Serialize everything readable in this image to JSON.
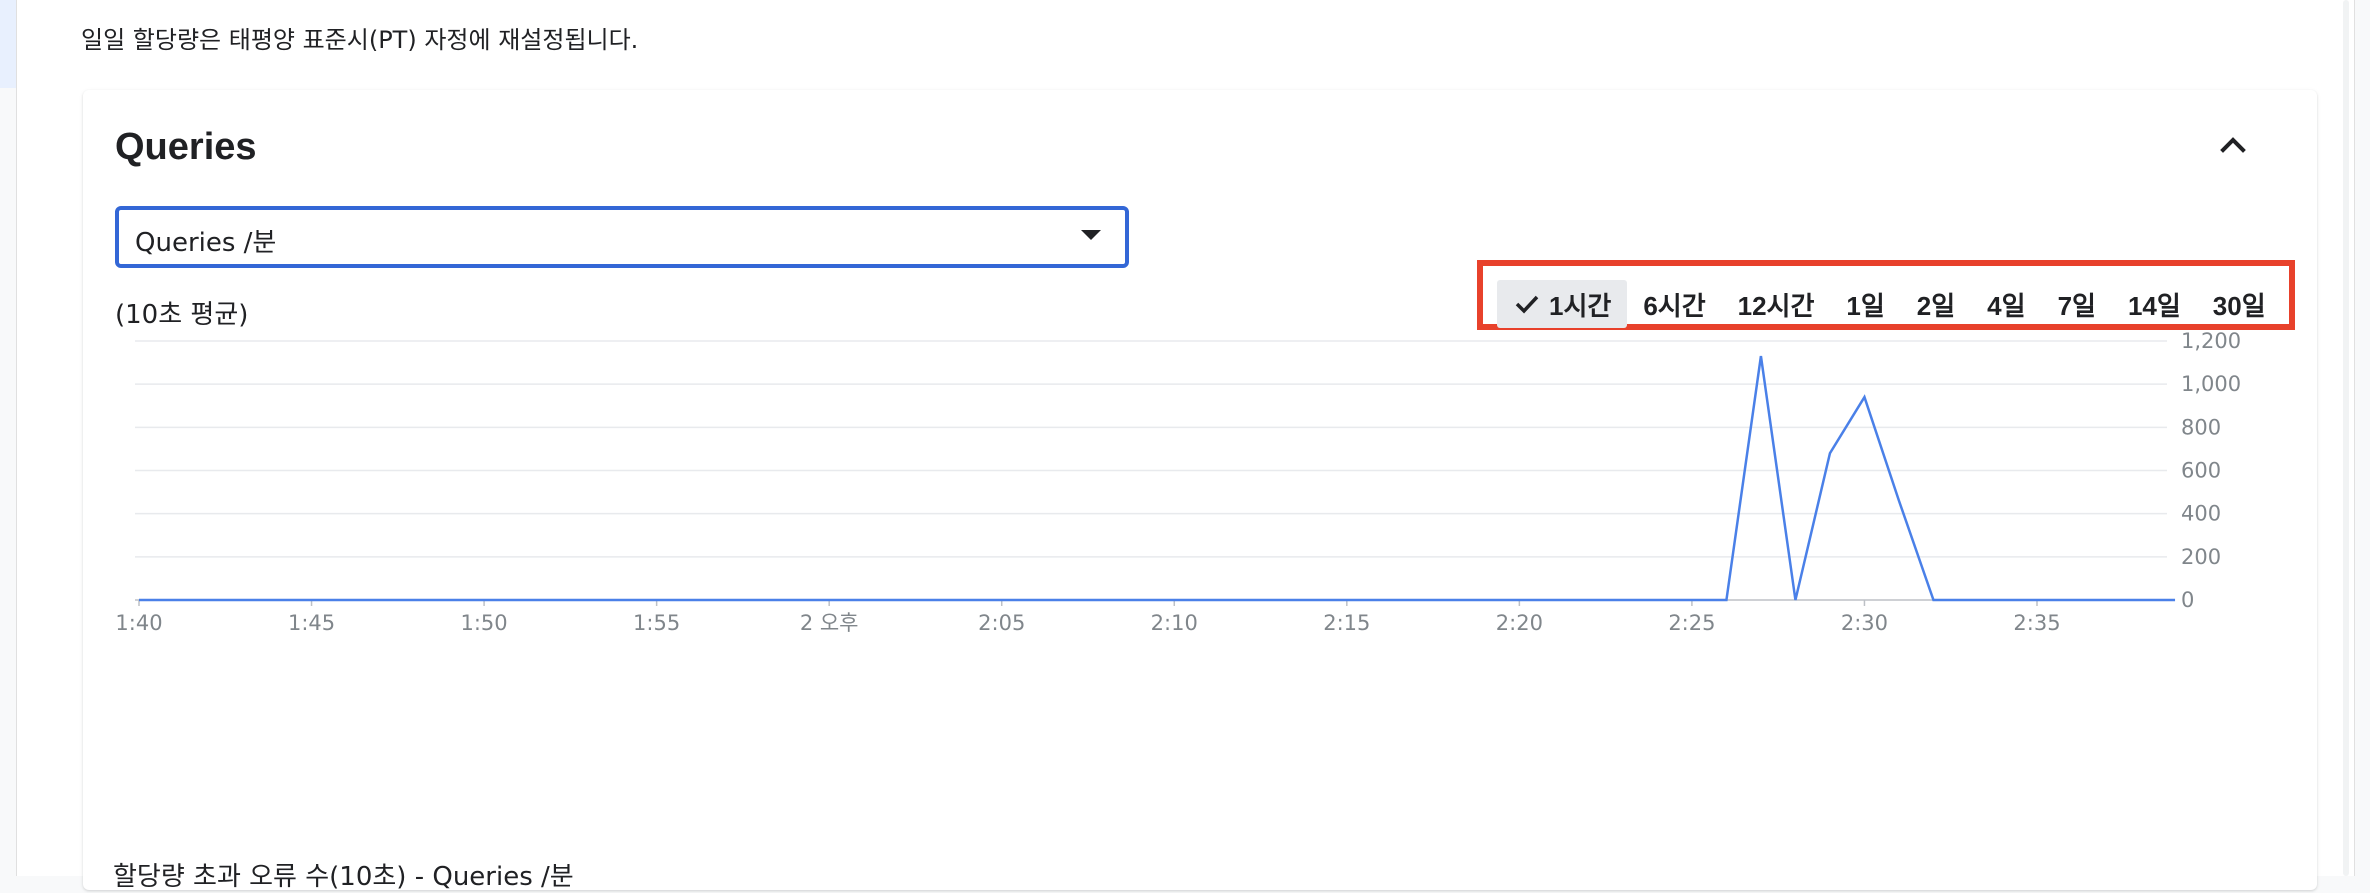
{
  "quota_reset_text": "일일 할당량은 태평양 표준시(PT) 자정에 재설정됩니다.",
  "card": {
    "title": "Queries",
    "collapse_icon": "chevron-up-icon",
    "metric_select": {
      "value": "Queries /분",
      "icon": "dropdown-arrow-icon"
    },
    "avg_note": "(10초 평균)",
    "time_ranges": [
      {
        "label": "1시간",
        "selected": true,
        "icon": "check-icon"
      },
      {
        "label": "6시간",
        "selected": false
      },
      {
        "label": "12시간",
        "selected": false
      },
      {
        "label": "1일",
        "selected": false
      },
      {
        "label": "2일",
        "selected": false
      },
      {
        "label": "4일",
        "selected": false
      },
      {
        "label": "7일",
        "selected": false
      },
      {
        "label": "14일",
        "selected": false
      },
      {
        "label": "30일",
        "selected": false
      }
    ],
    "bottom_label": "할당량 초과 오류 수(10초) - Queries /분"
  },
  "colors": {
    "line": "#4a80e8",
    "highlight": "#e8412b",
    "select_border": "#3367d6"
  },
  "chart_data": {
    "type": "line",
    "title": "",
    "xlabel": "",
    "ylabel": "",
    "ylim": [
      0,
      1200
    ],
    "yticks": [
      0,
      200,
      400,
      600,
      800,
      1000,
      1200
    ],
    "ytick_labels": [
      "0",
      "200",
      "400",
      "600",
      "800",
      "1,000",
      "1,200"
    ],
    "xlim": [
      100,
      159
    ],
    "xticks": [
      100,
      105,
      110,
      115,
      120,
      125,
      130,
      135,
      140,
      145,
      150,
      155
    ],
    "xtick_labels": [
      "1:40",
      "1:45",
      "1:50",
      "1:55",
      "2 오후",
      "2:05",
      "2:10",
      "2:15",
      "2:20",
      "2:25",
      "2:30",
      "2:35"
    ],
    "grid": true,
    "legend": "none",
    "series": [
      {
        "x": [
          100,
          146,
          147,
          148,
          149,
          150,
          151,
          152,
          159
        ],
        "y": [
          0,
          0,
          1130,
          0,
          680,
          940,
          460,
          0,
          0
        ]
      }
    ]
  }
}
